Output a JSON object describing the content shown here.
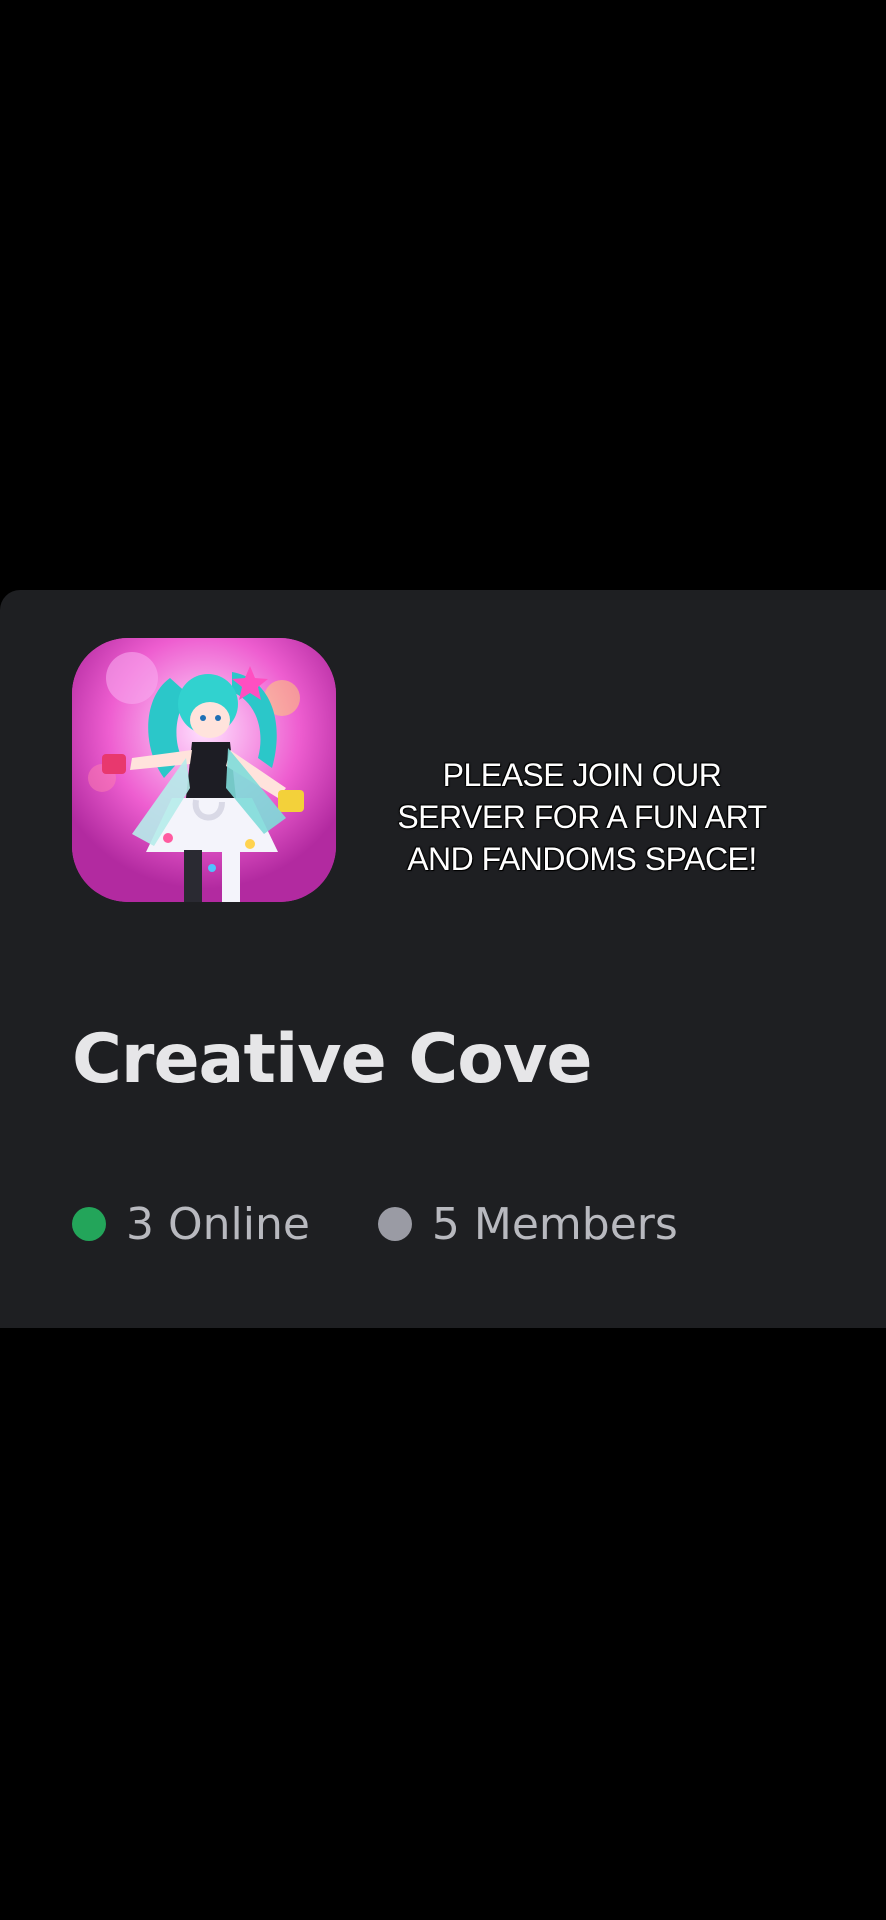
{
  "server": {
    "name": "Creative Cove",
    "icon": "server-icon-anime-character"
  },
  "overlay": {
    "caption": "PLEASE JOIN OUR\nSERVER FOR A FUN ART\nAND FANDOMS SPACE!"
  },
  "stats": {
    "online_text": "3 Online",
    "members_text": "5 Members",
    "online_color": "#23a55a",
    "members_color": "#9a9ba4"
  },
  "colors": {
    "card_background": "#1e1f22",
    "page_background": "#000000"
  }
}
